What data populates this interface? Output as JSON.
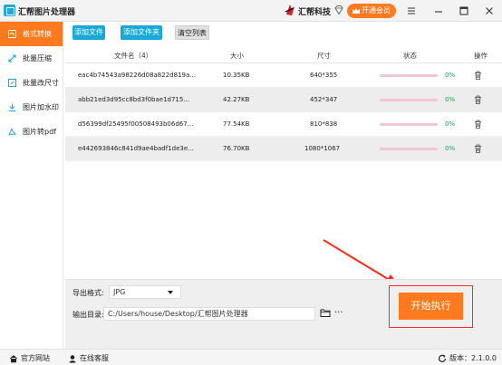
{
  "window": {
    "title": "汇帮图片处理器",
    "brand": "汇帮科技",
    "vip_label": "开通会员"
  },
  "sidebar": {
    "items": [
      {
        "label": "格式转换",
        "icon": "convert-icon",
        "active": true
      },
      {
        "label": "批量压缩",
        "icon": "compress-icon",
        "active": false
      },
      {
        "label": "批量改尺寸",
        "icon": "resize-icon",
        "active": false
      },
      {
        "label": "图片加水印",
        "icon": "watermark-icon",
        "active": false
      },
      {
        "label": "图片转pdf",
        "icon": "pdf-icon",
        "active": false
      }
    ]
  },
  "toolbar": {
    "add_file": "添加文件",
    "add_folder": "添加文件夹",
    "clear_list": "清空列表"
  },
  "table": {
    "headers": {
      "filename": "文件名（4）",
      "size": "大小",
      "dimensions": "尺寸",
      "status": "状态",
      "actions": "操作"
    },
    "rows": [
      {
        "name": "eac4b74543a98226d08a822d819a...",
        "size": "10.35KB",
        "dims": "640*355",
        "progress": 0,
        "pct": "0%"
      },
      {
        "name": "abb21ed3d95cc8bd3f0bae1d715...",
        "size": "42.27KB",
        "dims": "452*347",
        "progress": 0,
        "pct": "0%"
      },
      {
        "name": "d56399df25495f00508493b06d67...",
        "size": "77.54KB",
        "dims": "810*838",
        "progress": 0,
        "pct": "0%"
      },
      {
        "name": "e442693846c841d9ae4badf1de3e...",
        "size": "76.70KB",
        "dims": "1080*1067",
        "progress": 0,
        "pct": "0%"
      }
    ]
  },
  "export": {
    "format_label": "导出格式:",
    "format_value": "JPG",
    "dir_label": "输出目录:",
    "dir_value": "C:/Users/house/Desktop/汇帮图片处理器",
    "more": "···",
    "start_label": "开始执行"
  },
  "statusbar": {
    "website": "官方网站",
    "support": "在线客服",
    "version": "版本：2.1.0.0"
  },
  "colors": {
    "accent": "#ff7a1f",
    "blue": "#19a8d8",
    "progress": "#e54b6c",
    "arrow": "#ff2a1a"
  }
}
